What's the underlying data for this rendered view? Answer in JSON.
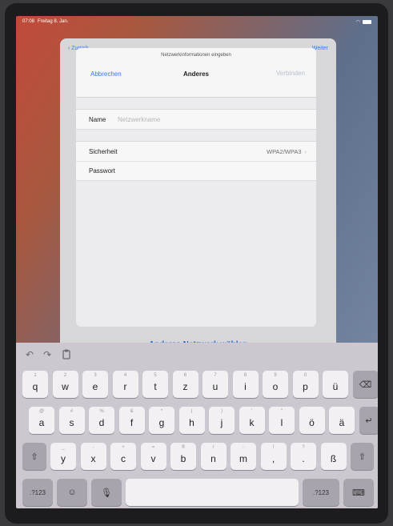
{
  "status": {
    "time": "07:08",
    "date": "Freitag 8. Jan.",
    "battery": ""
  },
  "back_sheet": {
    "back_label": "Zurück",
    "next_label": "Weiter",
    "other_network": "Anderes Netzwerk wählen"
  },
  "modal": {
    "caption": "Netzwerkinformationen eingeben",
    "cancel": "Abbrechen",
    "title": "Anderes",
    "connect": "Verbinden",
    "name_label": "Name",
    "name_placeholder": "Netzwerkname",
    "security_label": "Sicherheit",
    "security_value": "WPA2/WPA3",
    "password_label": "Passwort"
  },
  "keyboard": {
    "toolbar": [
      "undo-icon",
      "redo-icon",
      "paste-icon"
    ],
    "row1": [
      {
        "k": "q",
        "a": "1"
      },
      {
        "k": "w",
        "a": "2"
      },
      {
        "k": "e",
        "a": "3"
      },
      {
        "k": "r",
        "a": "4"
      },
      {
        "k": "t",
        "a": "5"
      },
      {
        "k": "z",
        "a": "6"
      },
      {
        "k": "u",
        "a": "7"
      },
      {
        "k": "i",
        "a": "8"
      },
      {
        "k": "o",
        "a": "9"
      },
      {
        "k": "p",
        "a": "0"
      },
      {
        "k": "ü",
        "a": ""
      }
    ],
    "row2": [
      {
        "k": "a",
        "a": "@"
      },
      {
        "k": "s",
        "a": "#"
      },
      {
        "k": "d",
        "a": "%"
      },
      {
        "k": "f",
        "a": "&"
      },
      {
        "k": "g",
        "a": "*"
      },
      {
        "k": "h",
        "a": "("
      },
      {
        "k": "j",
        "a": ")"
      },
      {
        "k": "k",
        "a": "'"
      },
      {
        "k": "l",
        "a": "\""
      },
      {
        "k": "ö",
        "a": ""
      },
      {
        "k": "ä",
        "a": ""
      }
    ],
    "row3": [
      {
        "k": "y",
        "a": "_"
      },
      {
        "k": "x",
        "a": "-"
      },
      {
        "k": "c",
        "a": "+"
      },
      {
        "k": "v",
        "a": "="
      },
      {
        "k": "b",
        "a": "®"
      },
      {
        "k": "n",
        "a": "/"
      },
      {
        "k": "m",
        "a": ";"
      },
      {
        "k": ",",
        "a": "!"
      },
      {
        "k": ".",
        "a": "?"
      },
      {
        "k": "ß",
        "a": ""
      }
    ],
    "num_label": ".?123",
    "num_label_right": ".?123"
  }
}
